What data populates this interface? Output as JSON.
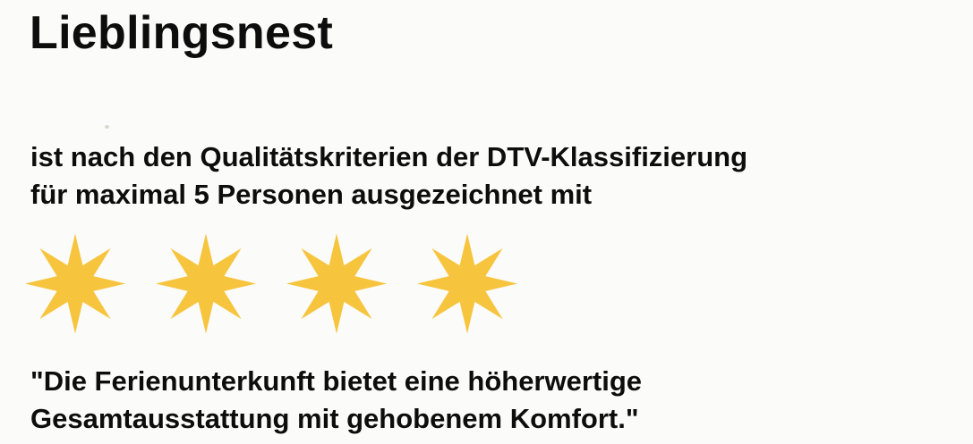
{
  "document": {
    "title": "Lieblingsnest",
    "statement_lines": [
      "ist nach den Qualitätskriterien der DTV-Klassifizierung",
      "für maximal 5 Personen ausgezeichnet mit"
    ],
    "rating": {
      "stars": 4,
      "star_color": "#f7c43d"
    },
    "quote_lines": [
      "\"Die Ferienunterkunft bietet eine höherwertige",
      "Gesamtausstattung mit gehobenem Komfort.\""
    ]
  }
}
